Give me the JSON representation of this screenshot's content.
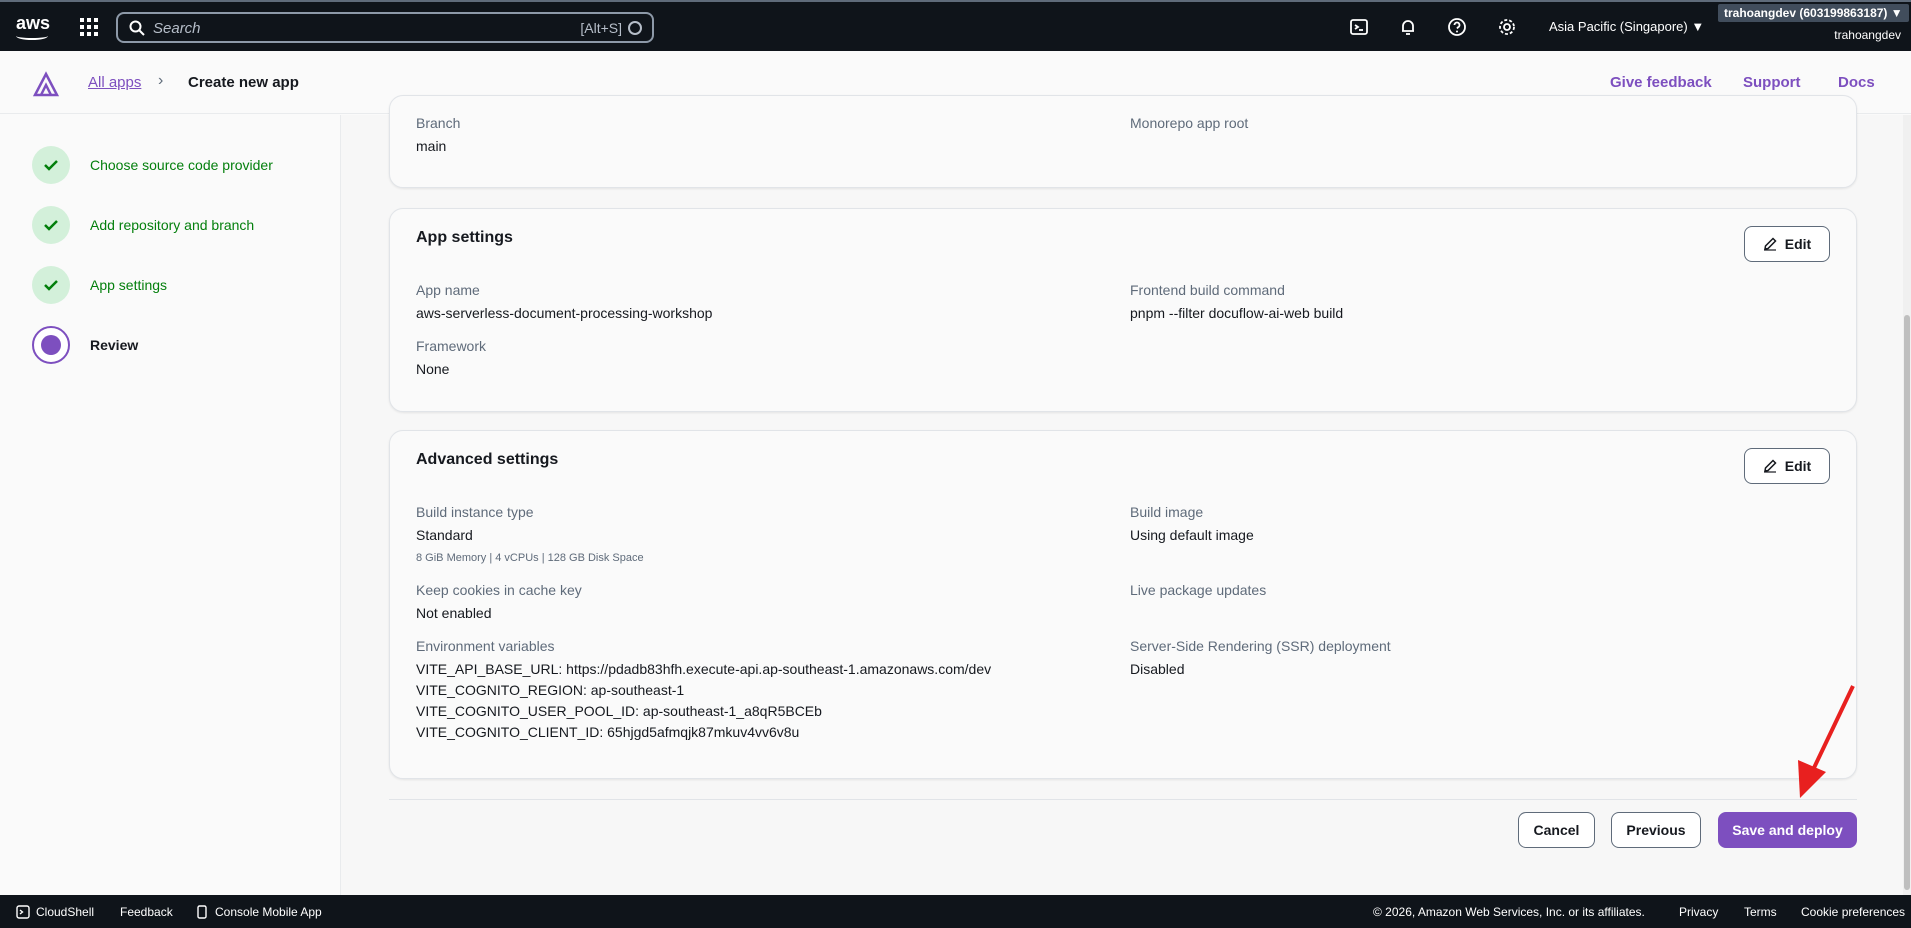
{
  "topnav": {
    "logo_text": "aws",
    "search_placeholder": "Search",
    "search_shortcut": "[Alt+S]",
    "region": "Asia Pacific (Singapore) ▼",
    "account_badge": "trahoangdev (603199863187) ▼",
    "account_name": "trahoangdev"
  },
  "header": {
    "breadcrumb_link": "All apps",
    "breadcrumb_current": "Create new app",
    "give_feedback": "Give feedback",
    "support": "Support",
    "docs": "Docs"
  },
  "wizard": {
    "steps": [
      {
        "label": "Choose source code provider",
        "state": "complete"
      },
      {
        "label": "Add repository and branch",
        "state": "complete"
      },
      {
        "label": "App settings",
        "state": "complete"
      },
      {
        "label": "Review",
        "state": "current"
      }
    ]
  },
  "repo_card": {
    "branch_label": "Branch",
    "branch_value": "main",
    "monorepo_label": "Monorepo app root"
  },
  "app_settings": {
    "title": "App settings",
    "edit_label": "Edit",
    "app_name_label": "App name",
    "app_name_value": "aws-serverless-document-processing-workshop",
    "framework_label": "Framework",
    "framework_value": "None",
    "build_cmd_label": "Frontend build command",
    "build_cmd_value": "pnpm --filter docuflow-ai-web build"
  },
  "advanced": {
    "title": "Advanced settings",
    "edit_label": "Edit",
    "instance_label": "Build instance type",
    "instance_value": "Standard",
    "instance_sub": "8 GiB Memory | 4 vCPUs | 128 GB Disk Space",
    "cookies_label": "Keep cookies in cache key",
    "cookies_value": "Not enabled",
    "env_label": "Environment variables",
    "env": [
      "VITE_API_BASE_URL:  https://pdadb83hfh.execute-api.ap-southeast-1.amazonaws.com/dev",
      "VITE_COGNITO_REGION:  ap-southeast-1",
      "VITE_COGNITO_USER_POOL_ID:  ap-southeast-1_a8qR5BCEb",
      "VITE_COGNITO_CLIENT_ID:  65hjgd5afmqjk87mkuv4vv6v8u"
    ],
    "image_label": "Build image",
    "image_value": "Using default image",
    "live_pkg_label": "Live package updates",
    "ssr_label": "Server-Side Rendering (SSR) deployment",
    "ssr_value": "Disabled"
  },
  "actions": {
    "cancel": "Cancel",
    "previous": "Previous",
    "save": "Save and deploy"
  },
  "footer": {
    "cloudshell": "CloudShell",
    "feedback": "Feedback",
    "mobile": "Console Mobile App",
    "copyright": "© 2026, Amazon Web Services, Inc. or its affiliates.",
    "privacy": "Privacy",
    "terms": "Terms",
    "cookies": "Cookie preferences"
  },
  "colors": {
    "primary": "#7d4fbf",
    "success": "#037f0c",
    "nav_bg": "#0f141a",
    "annotation_arrow": "#e8201f"
  }
}
